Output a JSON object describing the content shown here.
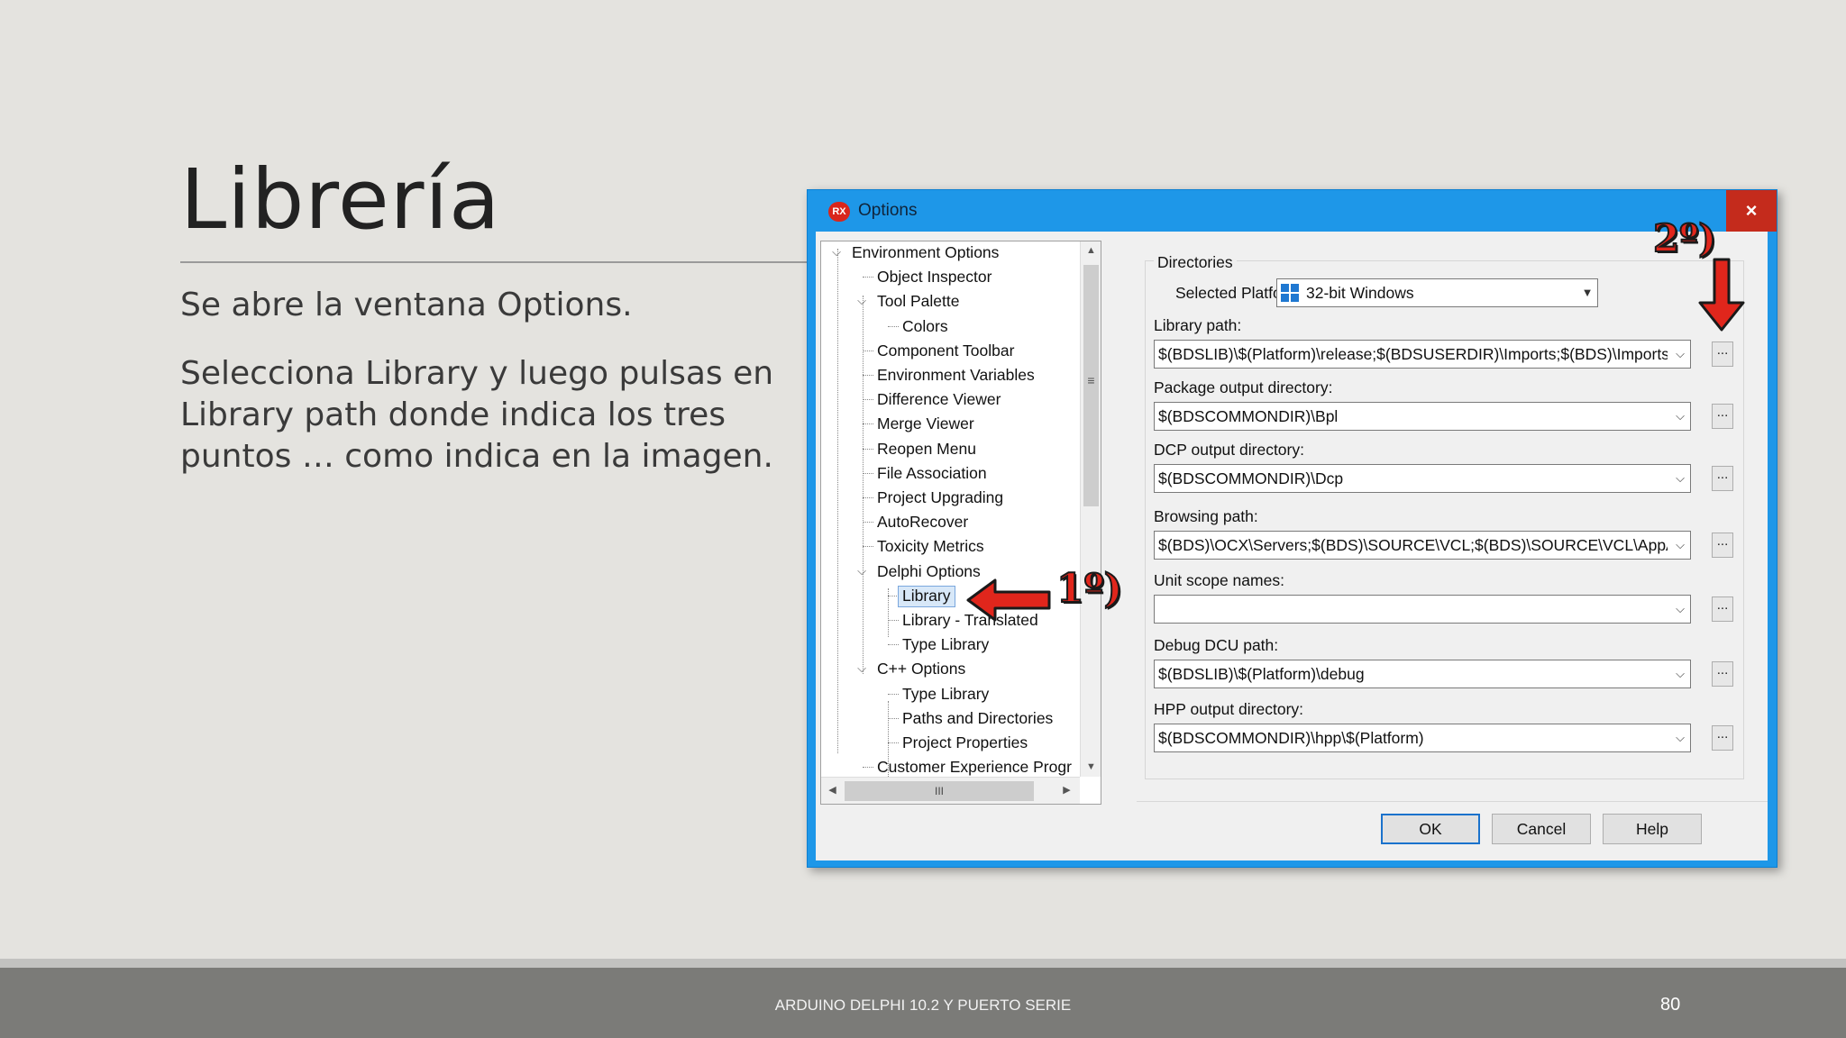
{
  "slide": {
    "title": "Librería",
    "paragraph1": "Se abre la ventana Options.",
    "paragraph2": "Selecciona Library y luego pulsas en Library path donde indica los tres puntos … como indica en la imagen.",
    "footer": "ARDUINO DELPHI 10.2 Y PUERTO SERIE",
    "page_number": "80"
  },
  "dialog": {
    "app_icon_text": "RX",
    "title": "Options",
    "close_label": "×",
    "tree": [
      {
        "label": "Environment Options",
        "level": 0,
        "expanded": true
      },
      {
        "label": "Object Inspector",
        "level": 1
      },
      {
        "label": "Tool Palette",
        "level": 1,
        "expanded": true
      },
      {
        "label": "Colors",
        "level": 2
      },
      {
        "label": "Component Toolbar",
        "level": 1
      },
      {
        "label": "Environment Variables",
        "level": 1
      },
      {
        "label": "Difference Viewer",
        "level": 1
      },
      {
        "label": "Merge Viewer",
        "level": 1
      },
      {
        "label": "Reopen Menu",
        "level": 1
      },
      {
        "label": "File Association",
        "level": 1
      },
      {
        "label": "Project Upgrading",
        "level": 1
      },
      {
        "label": "AutoRecover",
        "level": 1
      },
      {
        "label": "Toxicity Metrics",
        "level": 1
      },
      {
        "label": "Delphi Options",
        "level": 1,
        "expanded": true
      },
      {
        "label": "Library",
        "level": 2,
        "selected": true
      },
      {
        "label": "Library - Translated",
        "level": 2
      },
      {
        "label": "Type Library",
        "level": 2
      },
      {
        "label": "C++ Options",
        "level": 1,
        "expanded": true
      },
      {
        "label": "Type Library",
        "level": 2
      },
      {
        "label": "Paths and Directories",
        "level": 2
      },
      {
        "label": "Project Properties",
        "level": 2
      },
      {
        "label": "Customer Experience Progr",
        "level": 1
      }
    ],
    "scroll": {
      "up": "▲",
      "down": "▼",
      "grip": "≡",
      "left": "◀",
      "right": "▶",
      "hgrip": "III"
    },
    "directories": {
      "group_label": "Directories",
      "platform_label": "Selected Platform:",
      "platform_value": "32-bit Windows",
      "fields": [
        {
          "label": "Library path:",
          "value": "$(BDSLIB)\\$(Platform)\\release;$(BDSUSERDIR)\\Imports;$(BDS)\\Imports;"
        },
        {
          "label": "Package output directory:",
          "value": "$(BDSCOMMONDIR)\\Bpl"
        },
        {
          "label": "DCP output directory:",
          "value": "$(BDSCOMMONDIR)\\Dcp"
        },
        {
          "label": "Browsing path:",
          "value": "$(BDS)\\OCX\\Servers;$(BDS)\\SOURCE\\VCL;$(BDS)\\SOURCE\\VCL\\AppAn"
        },
        {
          "label": "Unit scope names:",
          "value": ""
        },
        {
          "label": "Debug DCU path:",
          "value": "$(BDSLIB)\\$(Platform)\\debug"
        },
        {
          "label": "HPP output directory:",
          "value": "$(BDSCOMMONDIR)\\hpp\\$(Platform)"
        }
      ],
      "browse_label": "..."
    },
    "buttons": {
      "ok": "OK",
      "cancel": "Cancel",
      "help": "Help"
    }
  },
  "annotations": {
    "step1": "1º)",
    "step2": "2º)",
    "color": "#e0261c"
  }
}
